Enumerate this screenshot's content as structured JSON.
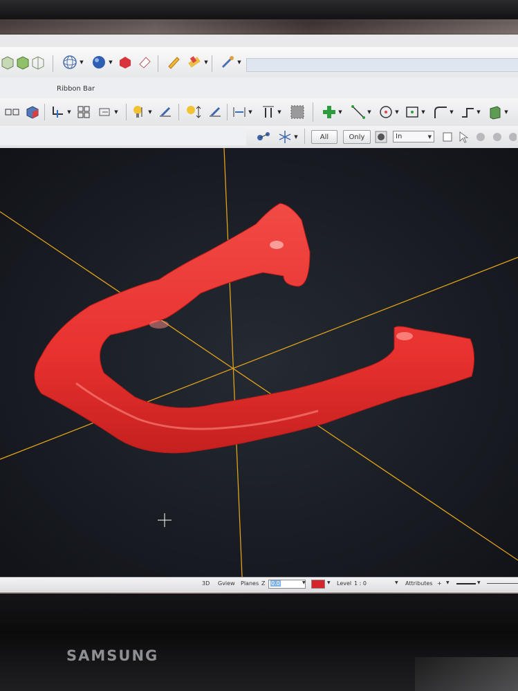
{
  "device": {
    "brand": "SAMSUNG"
  },
  "ribbon": {
    "caption": "Ribbon Bar"
  },
  "toolbar": {
    "selection": {
      "all_label": "All",
      "only_label": "Only",
      "mode_value": "In"
    }
  },
  "statusbar": {
    "view_mode": "3D",
    "gview": "Gview",
    "planes": "Planes",
    "z_label": "Z",
    "z_value": "0.0",
    "color_hex": "#d7262b",
    "level_label": "Level",
    "level_value": "1 : 0",
    "attributes_label": "Attributes"
  },
  "viewport": {
    "background": "#1b1e25",
    "model_color": "#e8322f",
    "axis_color": "#e0a21a",
    "cursor_icon": "crosshair-icon"
  }
}
